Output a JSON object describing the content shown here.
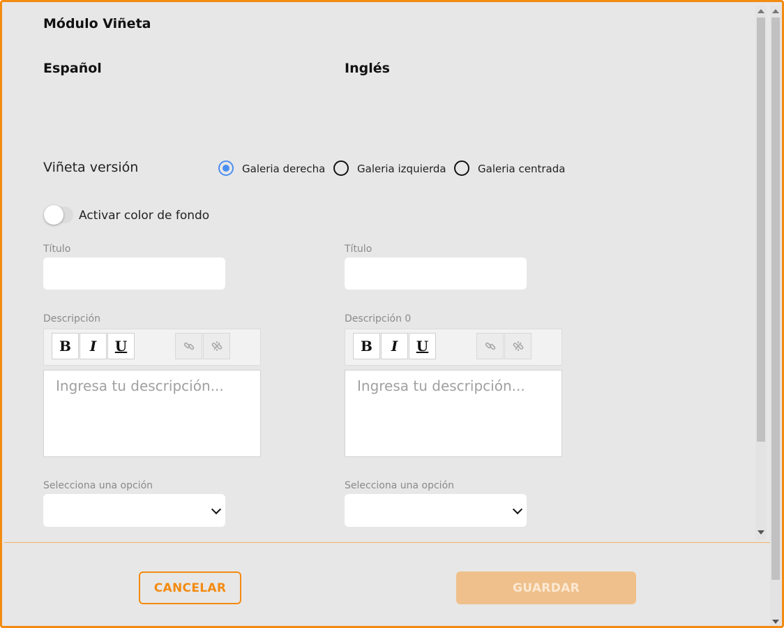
{
  "modal": {
    "title": "Módulo Viñeta",
    "col_es": "Español",
    "col_en": "Inglés"
  },
  "version": {
    "label": "Viñeta versión",
    "options": [
      {
        "label": "Galeria derecha",
        "checked": true
      },
      {
        "label": "Galeria izquierda",
        "checked": false
      },
      {
        "label": "Galeria centrada",
        "checked": false
      }
    ]
  },
  "toggle": {
    "label": "Activar color de fondo",
    "on": false
  },
  "es": {
    "title_label": "Título",
    "title_value": "",
    "desc_label": "Descripción",
    "desc_placeholder": "Ingresa tu descripción...",
    "select_label": "Selecciona una opción",
    "select_value": ""
  },
  "en": {
    "title_label": "Título",
    "title_value": "",
    "desc_label": "Descripción 0",
    "desc_placeholder": "Ingresa tu descripción...",
    "select_label": "Selecciona una opción",
    "select_value": ""
  },
  "toolbar": {
    "bold": "B",
    "italic": "I",
    "underline": "U"
  },
  "footer": {
    "cancel": "CANCELAR",
    "save": "GUARDAR"
  },
  "colors": {
    "accent": "#f38b12",
    "radio_checked": "#4a8ef0",
    "save_disabled": "#efc08b"
  }
}
